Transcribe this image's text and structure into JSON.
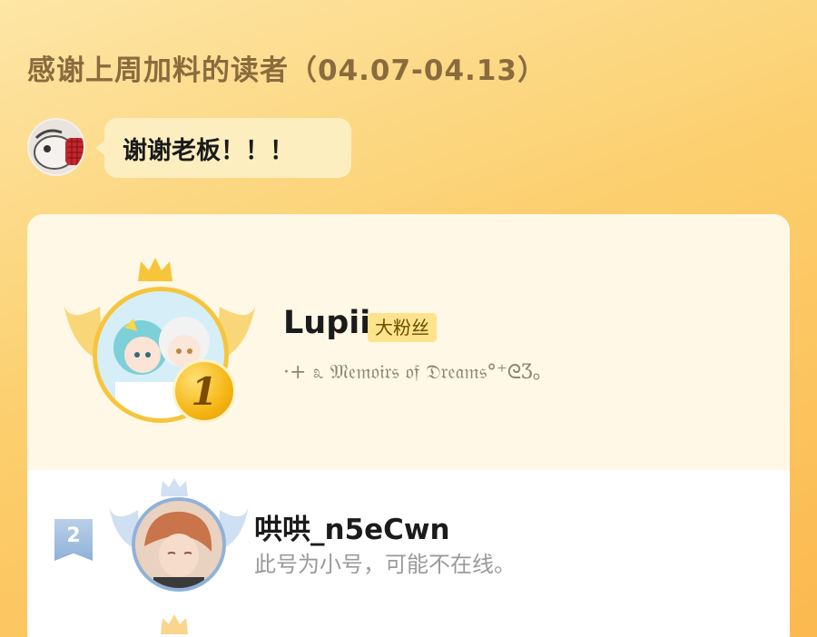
{
  "header": {
    "title": "感谢上周加料的读者（04.07-04.13）"
  },
  "owner_message": {
    "text": "谢谢老板！！！"
  },
  "ranking": [
    {
      "rank": "1",
      "name": "Lupii",
      "badge": "大粉丝",
      "signature": "·+ ೩ 𝔐𝔢𝔪𝔬𝔦𝔯𝔰 𝔬𝔣 𝔇𝔯𝔢𝔞𝔪𝔰°⁺ᘓƷ。"
    },
    {
      "rank": "2",
      "name": "哄哄_n5eCwn",
      "signature": "此号为小号，可能不在线。"
    }
  ],
  "colors": {
    "gold": "#f7c53c",
    "silver_blue": "#8fb2da",
    "title": "#8a6b3e"
  }
}
